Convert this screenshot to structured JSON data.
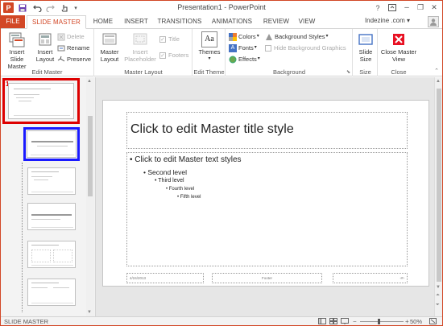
{
  "window": {
    "title": "Presentation1 - PowerPoint",
    "app_icon_letter": "P",
    "help_glyph": "?",
    "minimize_glyph": "–",
    "restore_glyph": "❐",
    "close_glyph": "✕"
  },
  "qat": {
    "save_icon": "save-icon",
    "undo_icon": "undo-icon",
    "redo_icon": "redo-icon",
    "touch_icon": "touch-mode-icon",
    "customize_icon": "customize-qat-icon"
  },
  "tabs": {
    "file": "FILE",
    "slide_master": "SLIDE MASTER",
    "home": "HOME",
    "insert": "INSERT",
    "transitions": "TRANSITIONS",
    "animations": "ANIMATIONS",
    "review": "REVIEW",
    "view": "VIEW"
  },
  "account": {
    "name": "Indezine .com",
    "dropdown": "▾"
  },
  "ribbon": {
    "edit_master": {
      "label": "Edit Master",
      "insert_slide_master": "Insert Slide Master",
      "insert_layout": "Insert Layout",
      "delete": "Delete",
      "rename": "Rename",
      "preserve": "Preserve"
    },
    "master_layout": {
      "label": "Master Layout",
      "master_layout_btn": "Master Layout",
      "insert_placeholder": "Insert Placeholder",
      "title": "Title",
      "footers": "Footers"
    },
    "edit_theme": {
      "label": "Edit Theme",
      "themes": "Themes",
      "themes_glyph": "Aa"
    },
    "background": {
      "label": "Background",
      "colors": "Colors",
      "fonts": "Fonts",
      "effects": "Effects",
      "background_styles": "Background Styles",
      "hide_background_graphics": "Hide Background Graphics"
    },
    "size": {
      "label": "Size",
      "slide_size": "Slide Size"
    },
    "close": {
      "label": "Close",
      "close_master_view": "Close Master View"
    }
  },
  "thumbnails": {
    "master_number": "1"
  },
  "slide": {
    "title_placeholder": "Click to edit Master title style",
    "levels": [
      "• Click to edit Master text styles",
      "• Second level",
      "• Third level",
      "• Fourth level",
      "• Fifth level"
    ],
    "date": "4/24/2013",
    "footer": "Footer",
    "slide_number": "‹#›"
  },
  "statusbar": {
    "view_name": "SLIDE MASTER",
    "zoom": "50%",
    "zoom_out": "−",
    "zoom_in": "+"
  },
  "colors": {
    "accent": "#d24726",
    "master_selection": "#dd0000",
    "layout_selection": "#1a1aff",
    "close_red": "#e81123"
  }
}
